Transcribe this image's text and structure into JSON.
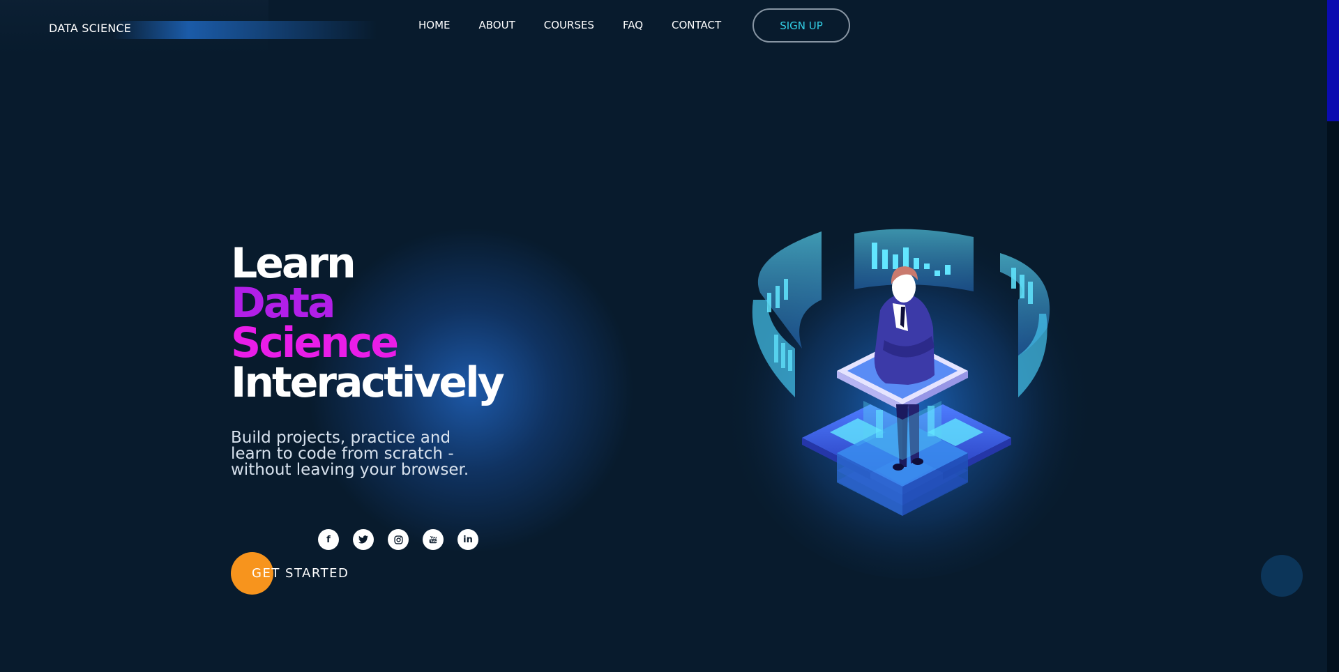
{
  "header": {
    "brand": "DATA SCIENCE",
    "nav": [
      "HOME",
      "ABOUT",
      "COURSES",
      "FAQ",
      "CONTACT"
    ],
    "signup_label": "SIGN UP"
  },
  "hero": {
    "title_line1": "Learn",
    "title_line2": "Data",
    "title_line3": "Science",
    "title_line4": "Interactively",
    "subtitle_line1": "Build projects, practice and",
    "subtitle_line2": "learn to code from scratch -",
    "subtitle_line3": "without leaving your browser.",
    "cta_label": "GET STARTED"
  },
  "socials": [
    {
      "icon": "facebook-icon",
      "glyph": "f"
    },
    {
      "icon": "twitter-icon",
      "glyph": "🐦"
    },
    {
      "icon": "instagram-icon",
      "glyph": "◎"
    },
    {
      "icon": "youtube-icon",
      "glyph": "▶"
    },
    {
      "icon": "linkedin-icon",
      "glyph": "in"
    }
  ],
  "colors": {
    "background": "#081b2d",
    "accent_purple": "#b21fe8",
    "accent_magenta": "#e91de8",
    "cta_orange": "#f7941d",
    "signup_text": "#33d0e6"
  }
}
